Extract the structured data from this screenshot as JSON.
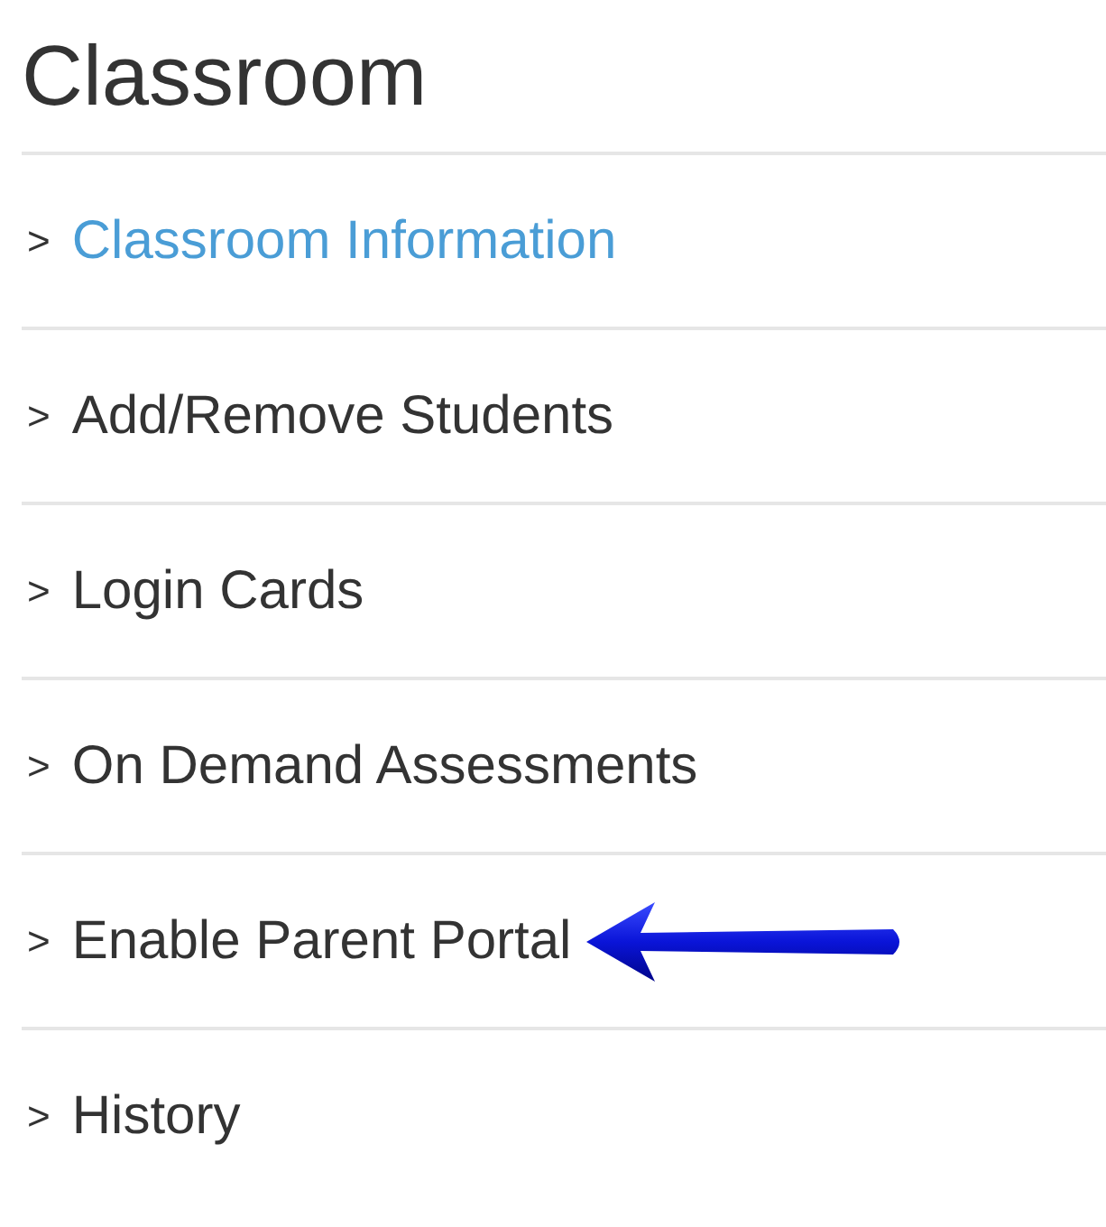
{
  "title": "Classroom",
  "items": [
    {
      "chevron": ">",
      "label": "Classroom Information",
      "selected": true,
      "pointed_at": false
    },
    {
      "chevron": ">",
      "label": "Add/Remove Students",
      "selected": false,
      "pointed_at": false
    },
    {
      "chevron": ">",
      "label": "Login Cards",
      "selected": false,
      "pointed_at": false
    },
    {
      "chevron": ">",
      "label": "On Demand Assessments",
      "selected": false,
      "pointed_at": false
    },
    {
      "chevron": ">",
      "label": "Enable Parent Portal",
      "selected": false,
      "pointed_at": true
    },
    {
      "chevron": ">",
      "label": "History",
      "selected": false,
      "pointed_at": false
    }
  ]
}
